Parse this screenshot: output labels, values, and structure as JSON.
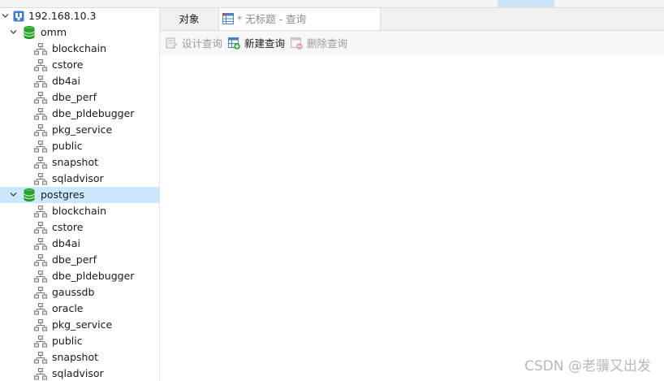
{
  "tree": {
    "connection": "192.168.10.3",
    "databases": [
      {
        "name": "omm",
        "selected": false,
        "schemas": [
          "blockchain",
          "cstore",
          "db4ai",
          "dbe_perf",
          "dbe_pldebugger",
          "pkg_service",
          "public",
          "snapshot",
          "sqladvisor"
        ]
      },
      {
        "name": "postgres",
        "selected": true,
        "schemas": [
          "blockchain",
          "cstore",
          "db4ai",
          "dbe_perf",
          "dbe_pldebugger",
          "gaussdb",
          "oracle",
          "pkg_service",
          "public",
          "snapshot",
          "sqladvisor"
        ]
      }
    ]
  },
  "tabs": {
    "objects": "对象",
    "query": "* 无标题 - 查询"
  },
  "actions": {
    "design": "设计查询",
    "new": "新建查询",
    "delete": "删除查询"
  },
  "watermark": "CSDN @老骥又出发",
  "colors": {
    "selected_row": "#cce8ff",
    "db_icon": "#2aa52a",
    "connection_icon": "#3a7bd5"
  }
}
